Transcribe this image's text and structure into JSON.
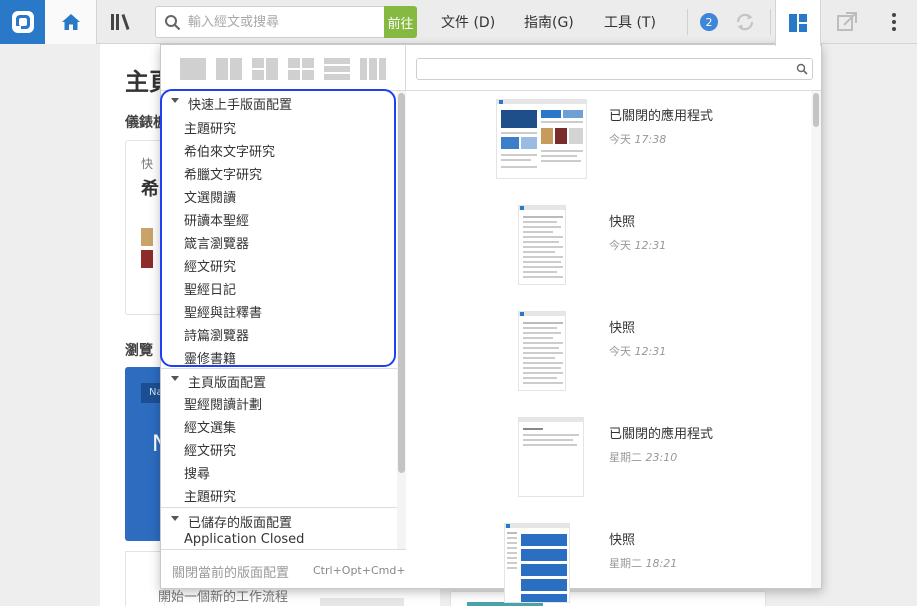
{
  "toolbar": {
    "search_placeholder": "輸入經文或搜尋",
    "go_label": "前往",
    "menu_file": "文件 (D)",
    "menu_guide": "指南(G)",
    "menu_tools": "工具 (T)",
    "badge_count": "2"
  },
  "background": {
    "page_title": "主頁",
    "dashboard_label": "儀錶板",
    "card_line1": "快",
    "card_line2": "希",
    "browse_label": "瀏覽",
    "blue_tag": "Na",
    "blue_letter": "N",
    "start_workflow": "開始一個新的工作流程"
  },
  "layouts_panel": {
    "groups": [
      {
        "label": "快速上手版面配置",
        "items": [
          "主題研究",
          "希伯來文字研究",
          "希臘文字研究",
          "文選閱讀",
          "研讀本聖經",
          "箴言瀏覽器",
          "經文研究",
          "聖經日記",
          "聖經與註釋書",
          "詩篇瀏覽器",
          "靈修書籍"
        ]
      },
      {
        "label": "主頁版面配置",
        "items": [
          "聖經閱讀計劃",
          "經文選集",
          "經文研究",
          "搜尋",
          "主題研究"
        ]
      },
      {
        "label": "已儲存的版面配置",
        "items": [
          "Application Closed"
        ]
      }
    ],
    "footer": {
      "close_label": "關閉當前的版面配置",
      "shortcut": "Ctrl+Opt+Cmd+X"
    }
  },
  "history": {
    "filter_placeholder": "",
    "entries": [
      {
        "title": "已關閉的應用程式",
        "day": "今天",
        "time": "17:38"
      },
      {
        "title": "快照",
        "day": "今天",
        "time": "12:31"
      },
      {
        "title": "快照",
        "day": "今天",
        "time": "12:31"
      },
      {
        "title": "已關閉的應用程式",
        "day": "星期二",
        "time": "23:10"
      },
      {
        "title": "快照",
        "day": "星期二",
        "time": "18:21"
      }
    ]
  },
  "colors": {
    "brand_blue": "#2a79c8",
    "go_green": "#86b942",
    "highlight_outline": "#1f3ff0"
  }
}
